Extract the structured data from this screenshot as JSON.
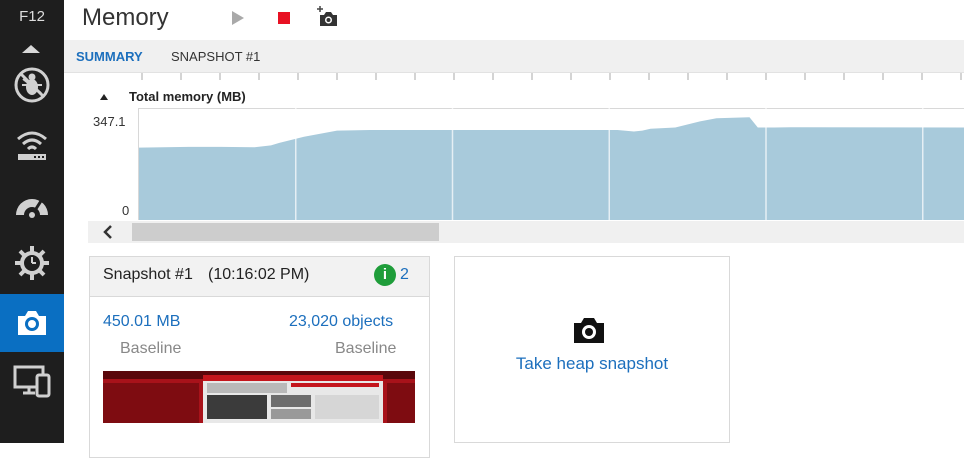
{
  "sidebar": {
    "title": "F12",
    "items": [
      {
        "icon": "bug-icon",
        "label": "Debugger"
      },
      {
        "icon": "network-icon",
        "label": "Network"
      },
      {
        "icon": "performance-icon",
        "label": "Performance"
      },
      {
        "icon": "responsiveness-icon",
        "label": "UI Responsiveness"
      },
      {
        "icon": "camera-icon",
        "label": "Memory",
        "active": true
      },
      {
        "icon": "emulation-icon",
        "label": "Emulation"
      }
    ]
  },
  "header": {
    "title": "Memory",
    "toolbar": [
      {
        "icon": "play-icon",
        "label": "Start profiling"
      },
      {
        "icon": "stop-icon",
        "label": "Stop profiling"
      },
      {
        "icon": "add-snapshot-icon",
        "label": "Take heap snapshot"
      }
    ]
  },
  "tabs": [
    {
      "label": "SUMMARY",
      "active": true
    },
    {
      "label": "SNAPSHOT #1",
      "active": false
    }
  ],
  "chart": {
    "title": "Total memory (MB)",
    "ymax_label": "347.1",
    "ymin_label": "0"
  },
  "chart_data": {
    "type": "area",
    "title": "Total memory (MB)",
    "ylim": [
      0,
      347.1
    ],
    "x": [
      0,
      0.06,
      0.1,
      0.14,
      0.16,
      0.17,
      0.2,
      0.24,
      0.28,
      0.5,
      0.58,
      0.6,
      0.61,
      0.62,
      0.65,
      0.68,
      0.7,
      0.74,
      0.75,
      0.77,
      0.79,
      0.8,
      1.0
    ],
    "values": [
      235,
      237,
      237,
      236,
      242,
      250,
      270,
      290,
      292,
      292,
      292,
      287,
      290,
      296,
      300,
      320,
      330,
      333,
      300,
      300,
      301,
      301,
      300
    ],
    "grid": true,
    "colors": {
      "fill": "#a8cadb",
      "grid": "#d8d8d8"
    }
  },
  "snapshot": {
    "name": "Snapshot #1",
    "time": "(10:16:02 PM)",
    "info_count": "2",
    "size": "450.01 MB",
    "objects": "23,020 objects",
    "size_caption": "Baseline",
    "objects_caption": "Baseline"
  },
  "take_snapshot": {
    "label": "Take heap snapshot"
  },
  "colors": {
    "accent": "#1c6fbd",
    "sidebar_bg": "#1e1e1e",
    "sidebar_active": "#0a6fc2",
    "stop": "#e81123",
    "info": "#1f9d3a"
  }
}
